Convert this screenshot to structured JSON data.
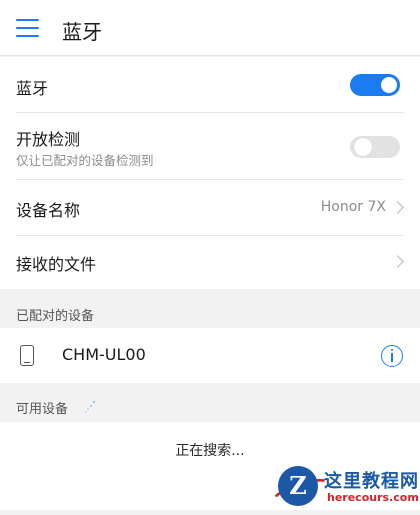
{
  "appbar": {
    "title": "蓝牙",
    "menu_icon": "menu-icon"
  },
  "settings": {
    "bluetooth": {
      "label": "蓝牙",
      "enabled": true
    },
    "discoverable": {
      "label": "开放检测",
      "sublabel": "仅让已配对的设备检测到",
      "enabled": false
    },
    "device_name": {
      "label": "设备名称",
      "value": "Honor 7X"
    },
    "received_files": {
      "label": "接收的文件"
    }
  },
  "paired": {
    "header": "已配对的设备",
    "devices": [
      {
        "name": "CHM-UL00",
        "icon": "phone-icon",
        "action_icon": "info-icon"
      }
    ]
  },
  "available": {
    "header": "可用设备",
    "status": "正在搜索..."
  },
  "watermark": {
    "logo_letter": "Z",
    "text": "这里教程网",
    "url": "herecours.com"
  },
  "colors": {
    "accent": "#1a7cf0",
    "toggle_off": "#e2e2e2",
    "background": "#f2f2f2"
  }
}
